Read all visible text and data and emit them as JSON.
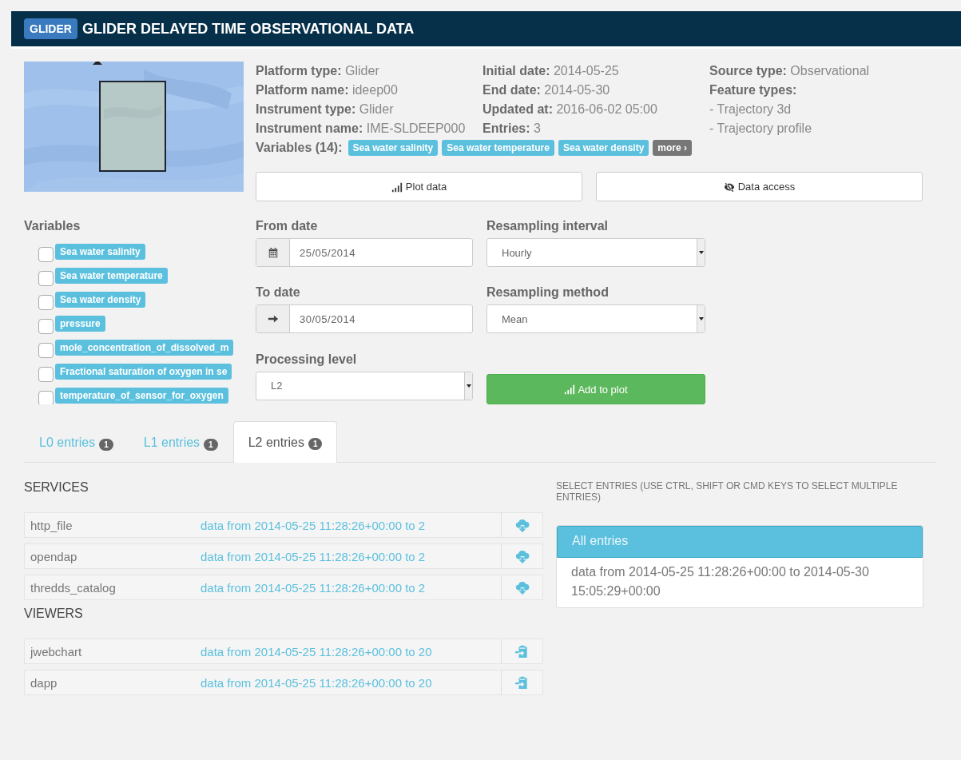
{
  "header": {
    "badge": "GLIDER",
    "title": "GLIDER DELAYED TIME OBSERVATIONAL DATA"
  },
  "metadata": {
    "column_1": [
      {
        "label": "Platform type:",
        "value": "Glider"
      },
      {
        "label": "Platform name:",
        "value": "ideep00"
      },
      {
        "label": "Instrument type:",
        "value": "Glider"
      },
      {
        "label": "Instrument name:",
        "value": "IME-SLDEEP000"
      }
    ],
    "column_2": [
      {
        "label": "Initial date:",
        "value": "2014-05-25"
      },
      {
        "label": "End date:",
        "value": "2014-05-30"
      },
      {
        "label": "Updated at:",
        "value": "2016-06-02 05:00"
      },
      {
        "label": "Entries:",
        "value": "3"
      }
    ],
    "column_3": [
      {
        "label": "Source type:",
        "value": "Observational"
      }
    ],
    "feature_types": {
      "label": "Feature types:",
      "items": [
        "- Trajectory 3d",
        "- Trajectory profile"
      ]
    }
  },
  "variables_summary": {
    "label": "Variables (14):",
    "tags": [
      "Sea water salinity",
      "Sea water temperature",
      "Sea water density"
    ],
    "more": "more ›"
  },
  "actions": [
    {
      "kind": "plot",
      "label": "Plot data"
    },
    {
      "kind": "access",
      "label": "Data access"
    }
  ],
  "variables": {
    "title": "Variables",
    "items": [
      {
        "label": "Sea water salinity",
        "checked": false
      },
      {
        "label": "Sea water temperature",
        "checked": false
      },
      {
        "label": "Sea water density",
        "checked": false
      },
      {
        "label": "pressure",
        "checked": false
      },
      {
        "label": "mole_concentration_of_dissolved_m",
        "checked": false
      },
      {
        "label": "Fractional saturation of oxygen in se",
        "checked": false
      },
      {
        "label": "temperature_of_sensor_for_oxygen",
        "checked": false
      }
    ]
  },
  "form": {
    "from_date": {
      "label": "From date",
      "value": "25/05/2014"
    },
    "to_date": {
      "label": "To date",
      "value": "30/05/2014"
    },
    "processing_level": {
      "label": "Processing level",
      "value": "L2"
    },
    "resampling_interval": {
      "label": "Resampling interval",
      "value": "Hourly"
    },
    "resampling_method": {
      "label": "Resampling method",
      "value": "Mean"
    },
    "add_button": "Add to plot"
  },
  "tabs": [
    {
      "label": "L0 entries",
      "count": "1",
      "selected": false
    },
    {
      "label": "L1 entries",
      "count": "1",
      "selected": false
    },
    {
      "label": "L2 entries",
      "count": "1",
      "selected": true
    }
  ],
  "sections": [
    {
      "title": "SERVICES",
      "kind": "download",
      "rows": [
        {
          "name": "http_file",
          "description": "data from 2014-05-25 11:28:26+00:00 to 2"
        },
        {
          "name": "opendap",
          "description": "data from 2014-05-25 11:28:26+00:00 to 2"
        },
        {
          "name": "thredds_catalog",
          "description": "data from 2014-05-25 11:28:26+00:00 to 2"
        }
      ]
    },
    {
      "title": "VIEWERS",
      "kind": "viewer",
      "rows": [
        {
          "name": "jwebchart",
          "description": "data from 2014-05-25 11:28:26+00:00 to 20"
        },
        {
          "name": "dapp",
          "description": "data from 2014-05-25 11:28:26+00:00 to 20"
        }
      ]
    }
  ],
  "entries": {
    "hint": "SELECT ENTRIES (USE CTRL, SHIFT OR CMD KEYS TO SELECT MULTIPLE ENTRIES)",
    "items": [
      {
        "label": "All entries",
        "selected": true
      },
      {
        "label": "data from 2014-05-25 11:28:26+00:00 to 2014-05-30 15:05:29+00:00",
        "selected": false
      }
    ]
  }
}
